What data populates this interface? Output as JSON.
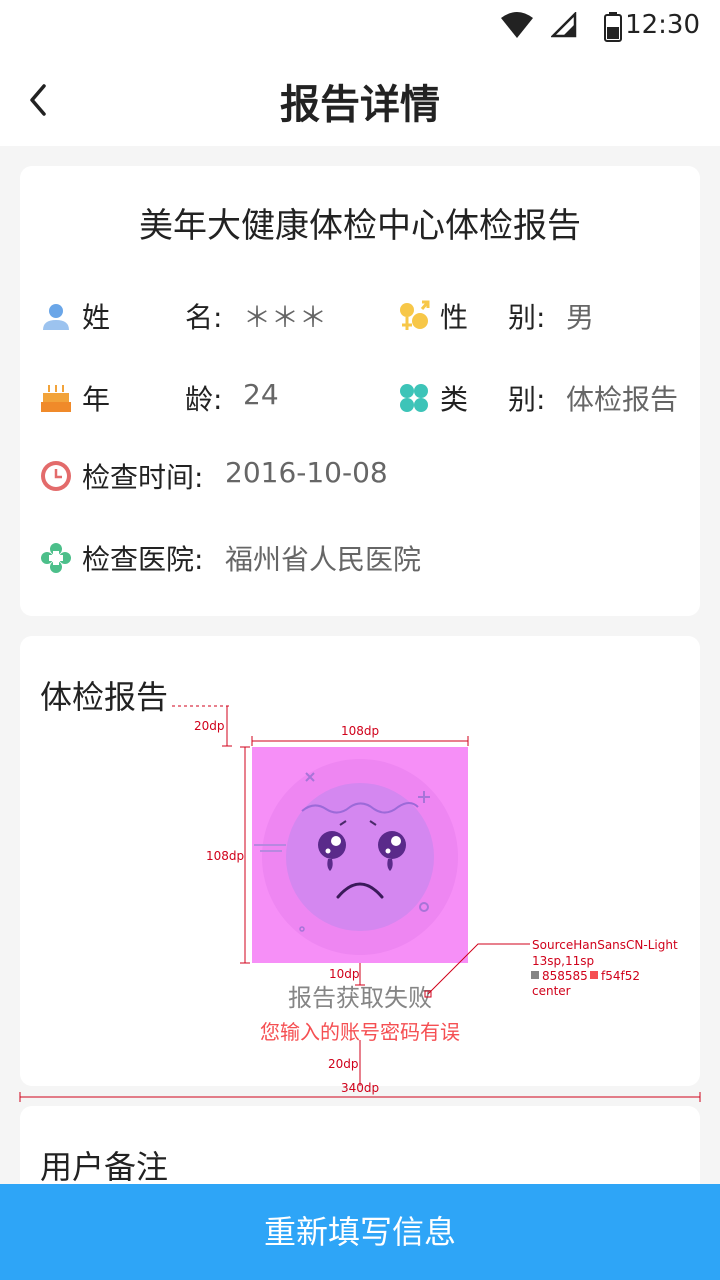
{
  "status_bar": {
    "time": "12:30"
  },
  "header": {
    "title": "报告详情"
  },
  "info_card": {
    "report_title": "美年大健康体检中心体检报告",
    "name": {
      "label_a": "姓",
      "label_b": "名:",
      "value": "＊＊＊"
    },
    "gender": {
      "label_a": "性",
      "label_b": "别:",
      "value": "男"
    },
    "age": {
      "label_a": "年",
      "label_b": "龄:",
      "value": "24"
    },
    "category": {
      "label_a": "类",
      "label_b": "别:",
      "value": "体检报告"
    },
    "exam_time": {
      "label": "检查时间:",
      "value": "2016-10-08"
    },
    "hospital": {
      "label": "检查医院:",
      "value": "福州省人民医院"
    }
  },
  "report_section": {
    "title": "体检报告",
    "fail_message": "报告获取失败",
    "fail_sub_message": "您输入的账号密码有误",
    "annotations": {
      "gap_top": "20dp",
      "width": "108dp",
      "height": "108dp",
      "gap_mid": "10dp",
      "gap_bottom": "20dp",
      "card_width": "340dp",
      "font_note_1": "SourceHanSansCN-Light",
      "font_note_2": "13sp,11sp",
      "color_note_1": "858585",
      "color_note_2": "f54f52",
      "align_note": "center"
    }
  },
  "notes_section": {
    "title": "用户备注"
  },
  "footer": {
    "button_label": "重新填写信息"
  },
  "colors": {
    "accent": "#2ea5f7",
    "error": "#f54f52",
    "muted": "#858585",
    "placeholder_bg": "#f68ff7"
  }
}
